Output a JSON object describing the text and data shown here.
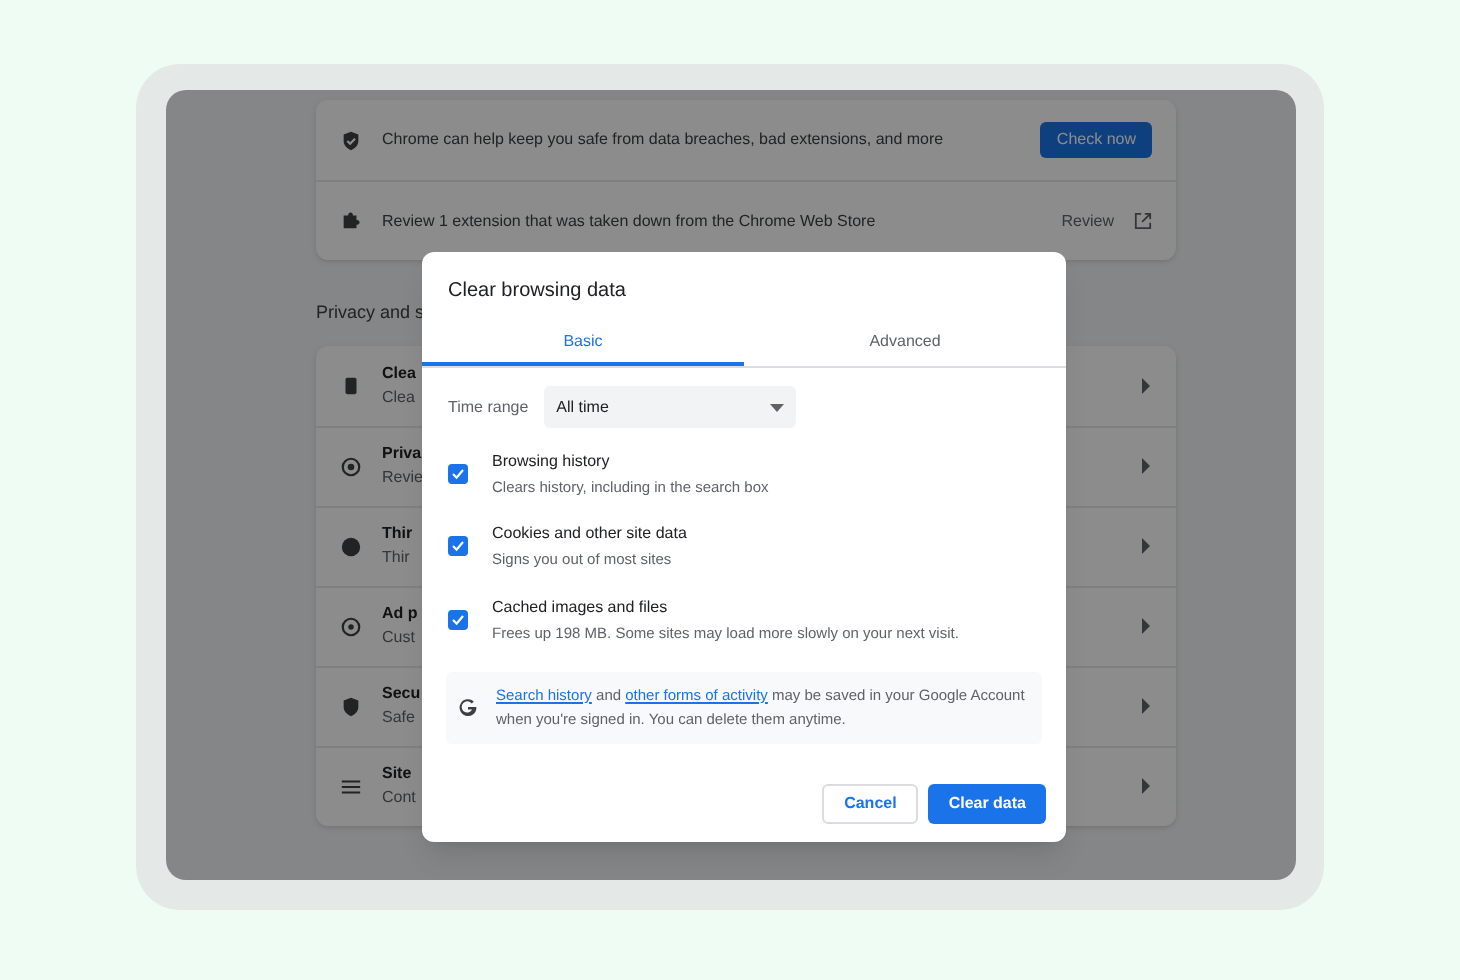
{
  "background_page": {
    "safety_card": {
      "rows": [
        {
          "kind": "action",
          "text": "Chrome can help keep you safe from data breaches, bad extensions, and more",
          "button": "Check now"
        },
        {
          "kind": "link",
          "text": "Review 1 extension that was taken down from the Chrome Web Store",
          "link": "Review"
        }
      ]
    },
    "privacy_heading": "Privacy and s",
    "privacy_items": [
      {
        "title": "Clea",
        "subtitle": "Clea"
      },
      {
        "title": "Priva",
        "subtitle": "Revie"
      },
      {
        "title": "Thir",
        "subtitle": "Thir"
      },
      {
        "title": "Ad p",
        "subtitle": "Cust"
      },
      {
        "title": "Secu",
        "subtitle": "Safe"
      },
      {
        "title": "Site",
        "subtitle": "Cont"
      }
    ]
  },
  "dialog": {
    "title": "Clear browsing data",
    "tabs": [
      {
        "label": "Basic",
        "selected": true
      },
      {
        "label": "Advanced",
        "selected": false
      }
    ],
    "time_range": {
      "label": "Time range",
      "value": "All time"
    },
    "options": [
      {
        "label": "Browsing history",
        "description": "Clears history, including in the search box",
        "checked": true
      },
      {
        "label": "Cookies and other site data",
        "description": "Signs you out of most sites",
        "checked": true
      },
      {
        "label": "Cached images and files",
        "description": "Frees up 198 MB. Some sites may load more slowly on your next visit.",
        "checked": true
      }
    ],
    "notice": {
      "link_1": "Search history",
      "text_1": " and ",
      "link_2": "other forms of activity",
      "text_2": " may be saved in your Google Account when you're signed in. You can delete them anytime."
    },
    "buttons": [
      {
        "kind": "secondary",
        "label": "Cancel"
      },
      {
        "kind": "primary",
        "label": "Clear data"
      }
    ]
  }
}
